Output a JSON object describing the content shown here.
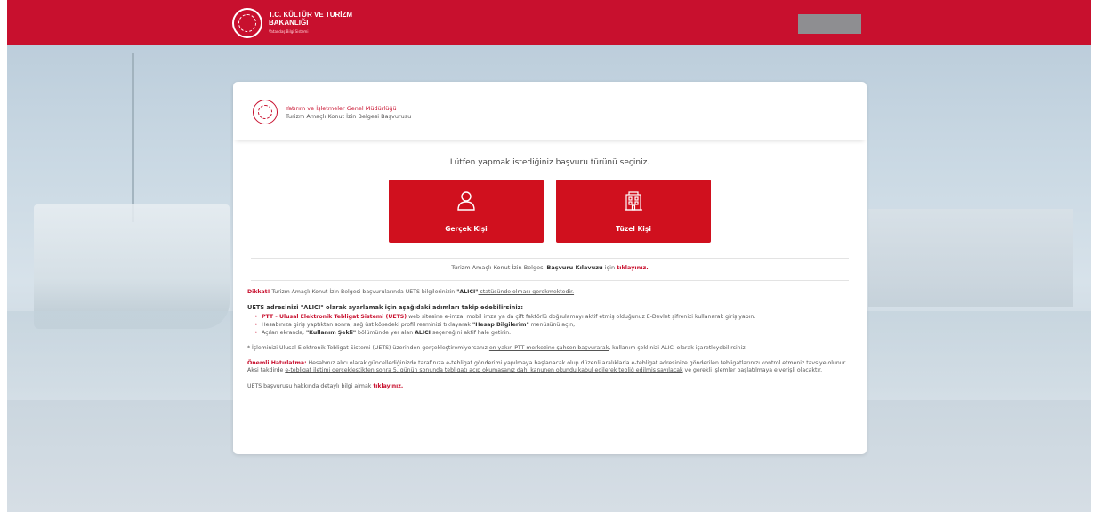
{
  "header": {
    "ministry_name": "T.C. KÜLTÜR VE TURİZM BAKANLIĞI",
    "ministry_sub": "Vatandaş Bilgi Sistemi",
    "brand_color": "#c8102e"
  },
  "card": {
    "dept": "Yatırım ve İşletmeler Genel Müdürlüğü",
    "service": "Turizm Amaçlı Konut İzin Belgesi Başvurusu",
    "prompt": "Lütfen yapmak istediğiniz başvuru türünü seçiniz.",
    "options": [
      {
        "label": "Gerçek Kişi",
        "icon": "person-icon"
      },
      {
        "label": "Tüzel Kişi",
        "icon": "building-icon"
      }
    ],
    "guide": {
      "pre": "Turizm Amaçlı Konut İzin Belgesi ",
      "bold": "Başvuru Kılavuzu",
      "mid": " için ",
      "link": "tıklayınız."
    }
  },
  "info": {
    "warn_label": "Dikkat!",
    "warn_pre": " Turizm Amaçlı Konut İzin Belgesi başvurularında UETS bilgilerinizin ",
    "warn_bold": "\"ALICI\"",
    "warn_post": " statüsünde olması gerekmektedir.",
    "steps_title": "UETS adresinizi \"ALICI\" olarak ayarlamak için aşağıdaki adımları takip edebilirsiniz:",
    "step1_link": "PTT - Ulusal Elektronik Tebligat Sistemi (UETS)",
    "step1_text": " web sitesine e-imza, mobil imza ya da çift faktörlü doğrulamayı aktif etmiş olduğunuz E-Devlet şifrenizi kullanarak giriş yapın.",
    "step2_pre": "Hesabınıza giriş yaptıktan sonra, sağ üst köşedeki profil resminizi tıklayarak ",
    "step2_bold": "\"Hesap Bilgilerim\"",
    "step2_post": " menüsünü açın,",
    "step3_pre": "Açılan ekranda, ",
    "step3_bold1": "\"Kullanım Şekli\"",
    "step3_mid": " bölümünde yer alan ",
    "step3_bold2": "ALICI",
    "step3_post": " seçeneğini aktif hale getirin.",
    "note_pre": "* İşleminizi Ulusal Elektronik Tebligat Sistemi (UETS) üzerinden gerçekleştiremiyorsanız ",
    "note_u": "en yakın PTT merkezine şahsen başvurarak",
    "note_post": ", kullanım şeklinizi ALICI olarak işaretleyebilirsiniz.",
    "reminder_label": "Önemli Hatırlatma:",
    "reminder_pre": " Hesabınız alıcı olarak güncellediğinizde tarafınıza e-tebligat gönderimi yapılmaya başlanacak olup düzenli aralıklarla e-tebligat adresinize gönderilen tebligatlarınızı kontrol etmeniz tavsiye olunur. Aksi takdirde ",
    "reminder_u": "e-tebligat iletimi gerçekleştikten sonra 5. günün sonunda tebligatı açıp okumasanız dahi kanunen okundu kabul edilerek tebliğ edilmiş sayılacak",
    "reminder_post": " ve gerekli işlemler başlatılmaya elverişli olacaktır.",
    "more_pre": "UETS başvurusu hakkında detaylı bilgi almak ",
    "more_link": "tıklayınız."
  }
}
